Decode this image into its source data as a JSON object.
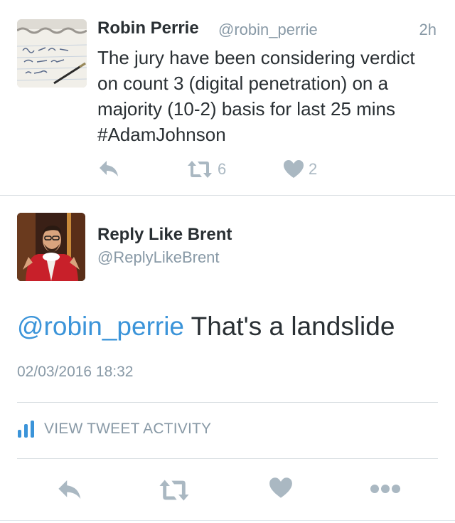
{
  "tweet_quoted": {
    "author_name": "Robin Perrie",
    "handle": "@robin_perrie",
    "time": "2h",
    "text": "The jury have been considering verdict on count 3 (digital penetration) on a majority (10-2) basis for last 25 mins #AdamJohnson",
    "retweet_count": "6",
    "like_count": "2",
    "avatar": "notepad-photo"
  },
  "tweet_main": {
    "author_name": "Reply Like Brent",
    "handle": "@ReplyLikeBrent",
    "mention": "@robin_perrie",
    "text": "That's a landslide",
    "timestamp": "02/03/2016 18:32",
    "avatar": "man-in-red-costume-photo"
  },
  "activity": {
    "label": "VIEW TWEET ACTIVITY",
    "icon": "bar-chart-icon"
  },
  "colors": {
    "link": "#3b94d9",
    "muted": "#8899a6",
    "icon": "#aab8c2",
    "text": "#292f33",
    "divider": "#d8dee2"
  }
}
